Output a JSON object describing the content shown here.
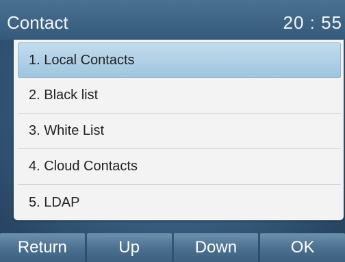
{
  "header": {
    "title": "Contact",
    "time": "20 : 55"
  },
  "menu": {
    "selected_index": 0,
    "items": [
      {
        "label": "1. Local Contacts"
      },
      {
        "label": "2. Black list"
      },
      {
        "label": "3. White List"
      },
      {
        "label": "4. Cloud Contacts"
      },
      {
        "label": "5. LDAP"
      }
    ]
  },
  "softkeys": [
    {
      "label": "Return"
    },
    {
      "label": "Up"
    },
    {
      "label": "Down"
    },
    {
      "label": "OK"
    }
  ]
}
